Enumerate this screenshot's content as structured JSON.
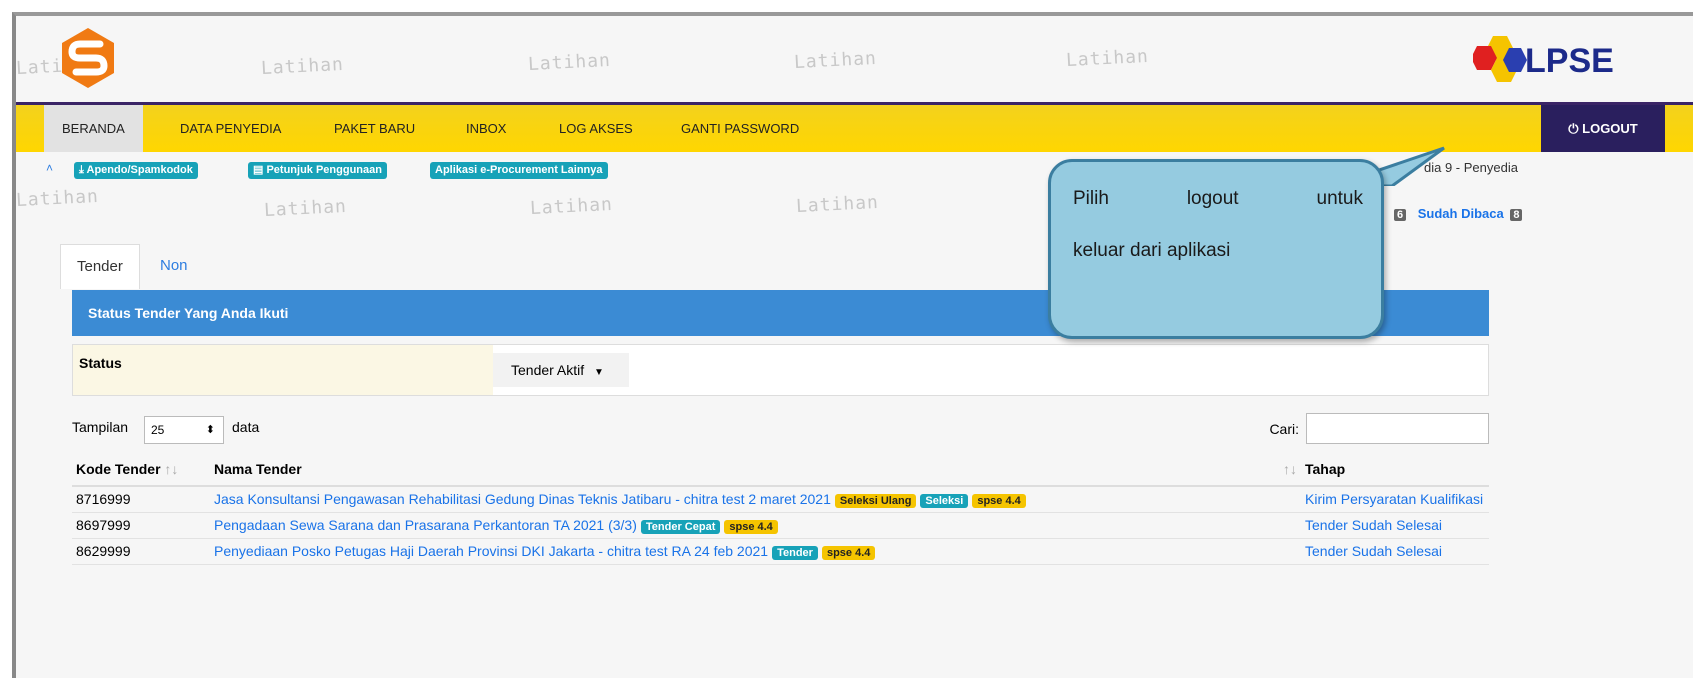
{
  "watermark_text": "Latihan",
  "header": {
    "brand": "LPSE"
  },
  "nav": {
    "items": [
      "BERANDA",
      "DATA PENYEDIA",
      "PAKET BARU",
      "INBOX",
      "LOG AKSES",
      "GANTI PASSWORD"
    ],
    "logout": "LOGOUT"
  },
  "subbar": {
    "links": [
      "Apendo/Spamkodok",
      "Petunjuk Penggunaan",
      "Aplikasi e-Procurement Lainnya"
    ],
    "user": "dia 9 - Penyedia",
    "inbox_count": "6",
    "read_label": "Sudah Dibaca",
    "read_count": "8"
  },
  "tabs": [
    "Tender",
    "Non Tender"
  ],
  "panel_title": "Status Tender Yang Anda Ikuti",
  "status": {
    "label": "Status",
    "value": "Tender Aktif"
  },
  "length": {
    "prefix": "Tampilan",
    "value": "25",
    "suffix": "data"
  },
  "search_label": "Cari:",
  "table": {
    "headers": [
      "Kode Tender",
      "Nama Tender",
      "Tahap"
    ],
    "rows": [
      {
        "kode": "8716999",
        "nama": "Jasa Konsultansi Pengawasan Rehabilitasi Gedung Dinas Teknis Jatibaru - chitra test 2 maret 2021",
        "badges": [
          {
            "text": "Seleksi Ulang",
            "color": "#f5c400",
            "fg": "#222"
          },
          {
            "text": "Seleksi",
            "color": "#17a2b8",
            "fg": "#fff"
          },
          {
            "text": "spse 4.4",
            "color": "#f5c400",
            "fg": "#222"
          }
        ],
        "tahap": "Kirim Persyaratan Kualifikasi"
      },
      {
        "kode": "8697999",
        "nama": "Pengadaan Sewa Sarana dan Prasarana Perkantoran TA 2021 (3/3)",
        "badges": [
          {
            "text": "Tender Cepat",
            "color": "#17a2b8",
            "fg": "#fff"
          },
          {
            "text": "spse 4.4",
            "color": "#f5c400",
            "fg": "#222"
          }
        ],
        "tahap": "Tender Sudah Selesai"
      },
      {
        "kode": "8629999",
        "nama": "Penyediaan Posko Petugas Haji Daerah Provinsi DKI Jakarta - chitra test RA 24 feb 2021",
        "badges": [
          {
            "text": "Tender",
            "color": "#17a2b8",
            "fg": "#fff"
          },
          {
            "text": "spse 4.4",
            "color": "#f5c400",
            "fg": "#222"
          }
        ],
        "tahap": "Tender Sudah Selesai"
      }
    ]
  },
  "callout": {
    "line1_words": [
      "Pilih",
      "logout",
      "untuk"
    ],
    "line2": "keluar dari aplikasi"
  },
  "colors": {
    "nav_bg": "#ffd600",
    "logout_bg": "#2a1f5e",
    "panel_bg": "#3b8bd4",
    "callout_bg": "#95cbe0"
  }
}
